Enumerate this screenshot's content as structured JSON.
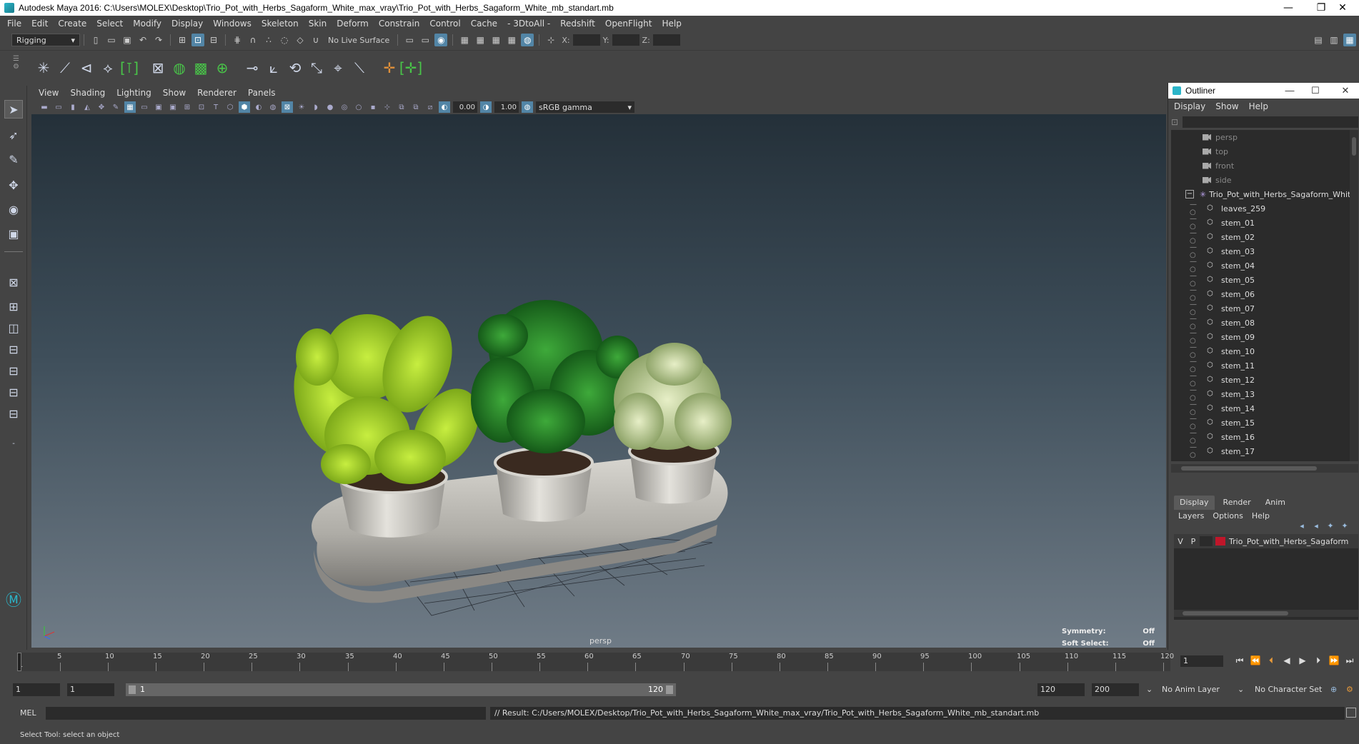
{
  "window": {
    "title": "Autodesk Maya 2016: C:\\Users\\MOLEX\\Desktop\\Trio_Pot_with_Herbs_Sagaform_White_max_vray\\Trio_Pot_with_Herbs_Sagaform_White_mb_standart.mb",
    "minimize": "—",
    "restore": "❐",
    "close": "✕"
  },
  "menubar": [
    "File",
    "Edit",
    "Create",
    "Select",
    "Modify",
    "Display",
    "Windows",
    "Skeleton",
    "Skin",
    "Deform",
    "Constrain",
    "Control",
    "Cache",
    "- 3DtoAll -",
    "Redshift",
    "OpenFlight",
    "Help"
  ],
  "statusline": {
    "menuset": "Rigging",
    "live_surface": "No Live Surface",
    "x_label": "X:",
    "y_label": "Y:",
    "z_label": "Z:"
  },
  "panel": {
    "menu": [
      "View",
      "Shading",
      "Lighting",
      "Show",
      "Renderer",
      "Panels"
    ],
    "exposure": "0.00",
    "gamma_value": "1.00",
    "color_space": "sRGB gamma",
    "camera_label": "persp",
    "hud": [
      {
        "label": "Symmetry:",
        "value": "Off"
      },
      {
        "label": "Soft Select:",
        "value": "Off"
      }
    ]
  },
  "outliner": {
    "title": "Outliner",
    "menu": [
      "Display",
      "Show",
      "Help"
    ],
    "cameras": [
      "persp",
      "top",
      "front",
      "side"
    ],
    "group": "Trio_Pot_with_Herbs_Sagaform_Whit",
    "children": [
      "leaves_259",
      "stem_01",
      "stem_02",
      "stem_03",
      "stem_04",
      "stem_05",
      "stem_06",
      "stem_07",
      "stem_08",
      "stem_09",
      "stem_10",
      "stem_11",
      "stem_12",
      "stem_13",
      "stem_14",
      "stem_15",
      "stem_16",
      "stem_17"
    ]
  },
  "layer_editor": {
    "tabs": [
      "Display",
      "Render",
      "Anim"
    ],
    "menu": [
      "Layers",
      "Options",
      "Help"
    ],
    "layer": {
      "v": "V",
      "p": "P",
      "name": "Trio_Pot_with_Herbs_Sagaform",
      "color": "#c0162a"
    }
  },
  "timeline": {
    "ticks": [
      "5",
      "10",
      "15",
      "20",
      "25",
      "30",
      "35",
      "40",
      "45",
      "50",
      "55",
      "60",
      "65",
      "70",
      "75",
      "80",
      "85",
      "90",
      "95",
      "100",
      "105",
      "110",
      "115",
      "120"
    ],
    "start_tick": "1",
    "current_frame": "1"
  },
  "range": {
    "start": "1",
    "playback_start": "1",
    "bar_start": "1",
    "bar_end": "120",
    "playback_end": "120",
    "end": "200",
    "anim_layer": "No Anim Layer",
    "character_set": "No Character Set"
  },
  "command": {
    "mel_label": "MEL",
    "result": "// Result: C:/Users/MOLEX/Desktop/Trio_Pot_with_Herbs_Sagaform_White_max_vray/Trio_Pot_with_Herbs_Sagaform_White_mb_standart.mb"
  },
  "help_line": "Select Tool: select an object"
}
